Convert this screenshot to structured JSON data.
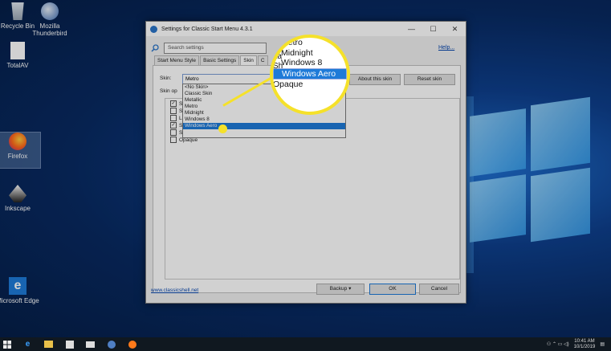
{
  "desktop": {
    "icons": [
      {
        "id": "recycle",
        "label": "Recycle Bin"
      },
      {
        "id": "thunderbird",
        "label": "Mozilla Thunderbird"
      },
      {
        "id": "totalav",
        "label": "TotalAV"
      },
      {
        "id": "firefox",
        "label": "Firefox"
      },
      {
        "id": "inkscape",
        "label": "Inkscape"
      },
      {
        "id": "edge",
        "label": "Microsoft Edge"
      }
    ]
  },
  "window": {
    "title": "Settings for Classic Start Menu 4.3.1",
    "controls": {
      "minimize": "—",
      "maximize": "☐",
      "close": "✕"
    },
    "search_placeholder": "Search settings",
    "help_link": "Help...",
    "tabs": [
      "Start Menu Style",
      "Basic Settings",
      "Skin",
      "C"
    ],
    "skin_label": "Skin:",
    "skin_value": "Metro",
    "about_button": "About this skin",
    "reset_button": "Reset skin",
    "skin_options_label": "Skin op",
    "options": [
      {
        "label": "Sh",
        "checked": true
      },
      {
        "label": "Sh",
        "checked": false
      },
      {
        "label": "La",
        "checked": false
      },
      {
        "label": "Sh",
        "checked": true
      },
      {
        "label": "Sh",
        "checked": false
      },
      {
        "label": "Opaque",
        "checked": false
      }
    ],
    "dropdown_items": [
      "<No Skin>",
      "Classic Skin",
      "Metallic",
      "Metro",
      "Midnight",
      "Windows 8",
      "Windows Aero"
    ],
    "dropdown_selected": "Windows Aero",
    "footer_link": "www.classicshell.net",
    "backup_button": "Backup",
    "ok_button": "OK",
    "cancel_button": "Cancel"
  },
  "magnifier": {
    "items": [
      "Metro",
      "Midnight",
      "Windows 8",
      "Windows Aero",
      "Opaque"
    ],
    "partial_labels": [
      "La",
      "Sh"
    ]
  },
  "taskbar": {
    "time": "10:41 AM",
    "date": "10/1/2019"
  },
  "colors": {
    "highlight": "#1e7ad8",
    "callout": "#f5e12a"
  }
}
